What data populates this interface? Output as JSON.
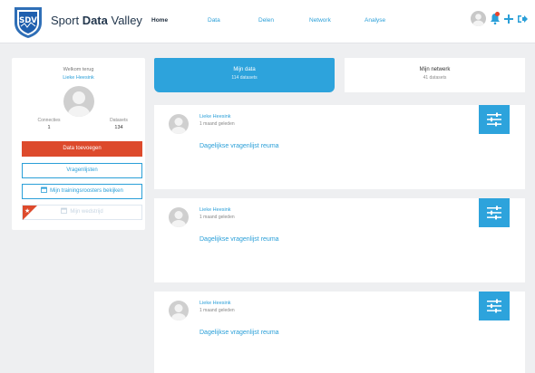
{
  "app": {
    "brand_prefix": "Sport ",
    "brand_strong": "Data",
    "brand_suffix": " Valley",
    "logo_text": "SDV"
  },
  "nav": {
    "items": [
      {
        "label": "Home",
        "active": true
      },
      {
        "label": "Data",
        "active": false
      },
      {
        "label": "Delen",
        "active": false
      },
      {
        "label": "Network",
        "active": false
      },
      {
        "label": "Analyse",
        "active": false
      }
    ]
  },
  "header_icons": [
    "avatar",
    "bell-icon",
    "plus-icon",
    "logout-icon"
  ],
  "profile": {
    "welcome": "Welkom terug",
    "name": "Lieke Heesink",
    "connections_label": "Connecties",
    "connections_value": "1",
    "datasets_label": "Datasets",
    "datasets_value": "134",
    "add_data_label": "Data toevoegen",
    "questionnaires_label": "Vragenlijsten",
    "training_label": "Mijn trainingsroosters bekijken",
    "training_icon": "calendar-icon",
    "extra_label": "Mijn wedstrijd",
    "extra_icon": "calendar-icon",
    "ribbon_icon": "star-icon"
  },
  "tabs": [
    {
      "title": "Mijn data",
      "subtitle": "114 datasets",
      "active": true
    },
    {
      "title": "Mijn netwerk",
      "subtitle": "41 datasets",
      "active": false
    }
  ],
  "posts": [
    {
      "author": "Lieke Heesink",
      "time": "1 maand geleden",
      "title": "Dagelijkse vragenlijst reuma"
    },
    {
      "author": "Lieke Heesink",
      "time": "1 maand geleden",
      "title": "Dagelijkse vragenlijst reuma"
    },
    {
      "author": "Lieke Heesink",
      "time": "1 maand geleden",
      "title": "Dagelijkse vragenlijst reuma"
    }
  ],
  "colors": {
    "primary": "#2da3dc",
    "danger": "#dd4a2c",
    "background": "#eeeff1",
    "navy": "#23374d"
  }
}
